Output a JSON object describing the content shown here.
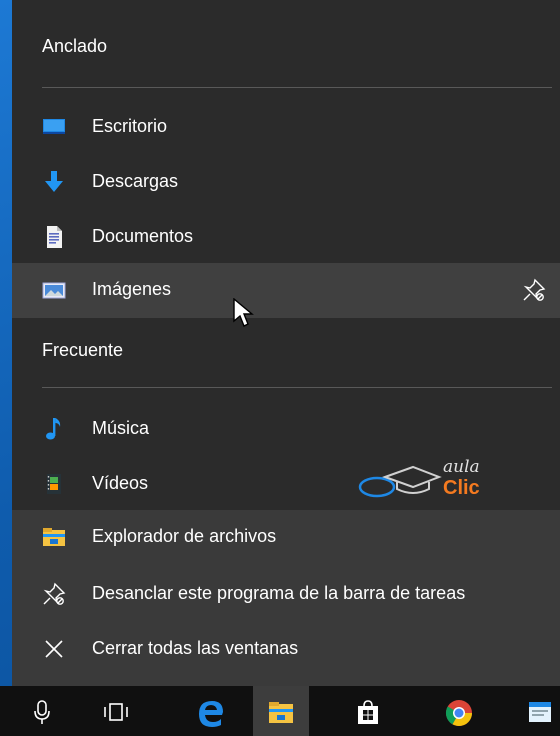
{
  "jumplist": {
    "pinned_header": "Anclado",
    "pinned_items": [
      {
        "label": "Escritorio",
        "icon": "desktop-icon"
      },
      {
        "label": "Descargas",
        "icon": "download-arrow-icon"
      },
      {
        "label": "Documentos",
        "icon": "document-icon"
      },
      {
        "label": "Imágenes",
        "icon": "pictures-icon",
        "hovered": true,
        "action_icon": "unpin-icon"
      }
    ],
    "frequent_header": "Frecuente",
    "frequent_items": [
      {
        "label": "Música",
        "icon": "music-note-icon"
      },
      {
        "label": "Vídeos",
        "icon": "video-icon"
      }
    ],
    "tasks": [
      {
        "label": "Explorador de archivos",
        "icon": "file-explorer-icon"
      },
      {
        "label": "Desanclar este programa de la barra de tareas",
        "icon": "unpin-icon"
      },
      {
        "label": "Cerrar todas las ventanas",
        "icon": "close-icon"
      }
    ]
  },
  "watermark": {
    "line1": "aula",
    "line2": "Clic"
  },
  "taskbar": {
    "items": [
      "microphone-icon",
      "task-view-icon",
      "edge-icon",
      "file-explorer-icon",
      "store-icon",
      "chrome-icon",
      "app-icon"
    ],
    "active": "file-explorer-icon"
  },
  "colors": {
    "menu_bg": "#2b2b2b",
    "hover_bg": "#404040",
    "tasks_bg": "#3a3a3a",
    "accent_blue": "#2196f3",
    "folder_yellow": "#f5c342",
    "watermark_orange": "#f47a20"
  }
}
